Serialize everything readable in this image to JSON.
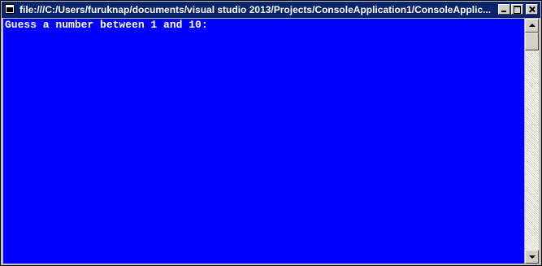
{
  "window": {
    "title": "file:///C:/Users/furuknap/documents/visual studio 2013/Projects/ConsoleApplication1/ConsoleApplic...",
    "icon": "console-window-icon",
    "controls": [
      "minimize-icon",
      "maximize-icon",
      "close-icon"
    ]
  },
  "console": {
    "background": "#0000ff",
    "foreground": "#ffffff",
    "lines": [
      "Guess a number between 1 and 10:"
    ]
  },
  "colors": {
    "titlebar": "#0a246a",
    "chrome": "#d4d0c8"
  }
}
